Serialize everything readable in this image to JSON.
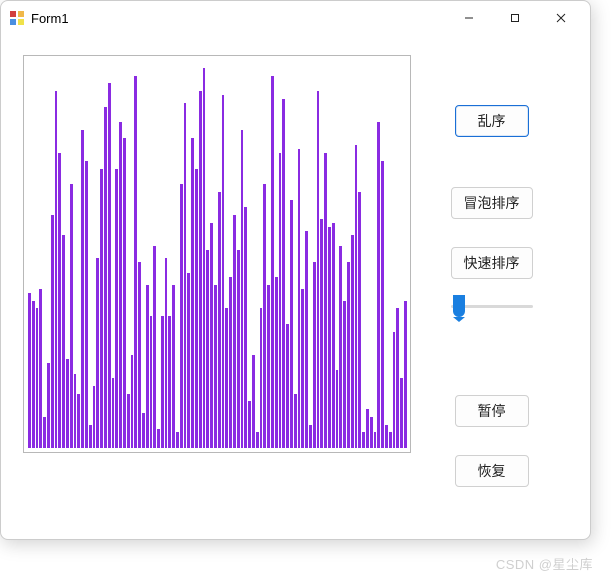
{
  "window": {
    "title": "Form1"
  },
  "buttons": {
    "shuffle": "乱序",
    "bubble_sort": "冒泡排序",
    "quick_sort": "快速排序",
    "pause": "暂停",
    "resume": "恢复"
  },
  "slider": {
    "min": 0,
    "max": 100,
    "value": 10
  },
  "watermark": "CSDN @星尘库",
  "colors": {
    "bar": "#8A2BE2",
    "accent": "#1a6fd6"
  },
  "chart_data": {
    "type": "bar",
    "title": "",
    "xlabel": "",
    "ylabel": "",
    "ylim": [
      0,
      100
    ],
    "categories": [],
    "values": [
      40,
      38,
      36,
      41,
      8,
      22,
      60,
      92,
      76,
      55,
      23,
      68,
      19,
      14,
      82,
      74,
      6,
      16,
      49,
      72,
      88,
      94,
      18,
      72,
      84,
      80,
      14,
      24,
      96,
      48,
      9,
      42,
      34,
      52,
      5,
      34,
      49,
      34,
      42,
      4,
      68,
      89,
      45,
      80,
      72,
      92,
      98,
      51,
      58,
      42,
      66,
      91,
      36,
      44,
      60,
      51,
      82,
      62,
      12,
      24,
      4,
      36,
      68,
      42,
      96,
      44,
      76,
      90,
      32,
      64,
      14,
      77,
      41,
      56,
      6,
      48,
      92,
      59,
      76,
      57,
      58,
      20,
      52,
      38,
      48,
      55,
      78,
      66,
      4,
      10,
      8,
      4,
      84,
      74,
      6,
      4,
      30,
      36,
      18,
      38
    ]
  }
}
